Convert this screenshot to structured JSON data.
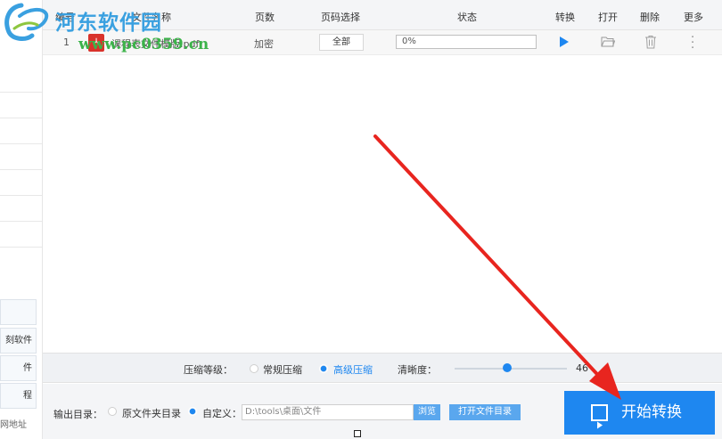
{
  "watermark": {
    "title": "河东软件园",
    "url": "www.pc0359.cn"
  },
  "table": {
    "headers": {
      "index": "编号",
      "name": "文件名称",
      "pages": "页数",
      "page_select": "页码选择",
      "status": "状态",
      "convert": "转换",
      "open": "打开",
      "delete": "删除",
      "more": "更多"
    },
    "rows": [
      {
        "index": "1",
        "name": "课程表文件模版.pdf",
        "pages": "加密",
        "page_select": "全部",
        "progress_text": "0%",
        "progress": 0
      }
    ]
  },
  "sidebar": {
    "boxes": [
      "刻软件",
      "件",
      "程"
    ],
    "link": "网地址"
  },
  "options": {
    "level_label": "压缩等级：",
    "normal_label": "常规压缩",
    "advanced_label": "高级压缩",
    "selected": "advanced",
    "clarity_label": "清晰度：",
    "clarity_value": "46"
  },
  "output": {
    "dir_label": "输出目录：",
    "original_label": "原文件夹目录",
    "custom_label": "自定义：",
    "path_value": "D:\\tools\\桌面\\文件",
    "browse_label": "浏览",
    "open_dir_label": "打开文件目录",
    "start_label": "开始转换"
  },
  "colors": {
    "accent": "#1e87f0",
    "arrow": "#e8251f",
    "pdf": "#d9322b"
  }
}
